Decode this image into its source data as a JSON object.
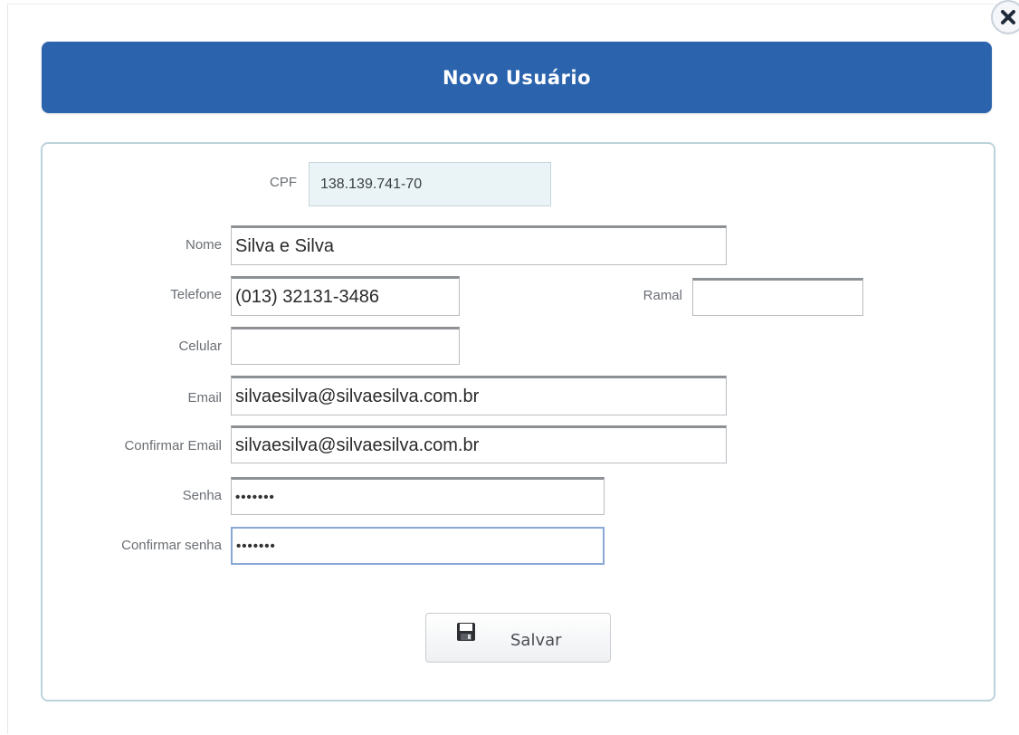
{
  "dialog": {
    "title": "Novo Usuário",
    "close_icon": "close-icon"
  },
  "form": {
    "cpf": {
      "label": "CPF",
      "value": "138.139.741-70"
    },
    "nome": {
      "label": "Nome",
      "value": "Silva e Silva"
    },
    "telefone": {
      "label": "Telefone",
      "value": "(013) 32131-3486"
    },
    "ramal": {
      "label": "Ramal",
      "value": ""
    },
    "celular": {
      "label": "Celular",
      "value": ""
    },
    "email": {
      "label": "Email",
      "value": "silvaesilva@silvaesilva.com.br"
    },
    "confirmar_email": {
      "label": "Confirmar Email",
      "value": "silvaesilva@silvaesilva.com.br"
    },
    "senha": {
      "label": "Senha",
      "value": "•••••••"
    },
    "confirmar_senha": {
      "label": "Confirmar senha",
      "value": "•••••••"
    }
  },
  "actions": {
    "save_label": "Salvar",
    "save_icon": "floppy-disk-icon"
  },
  "colors": {
    "header_bg": "#2b63ad",
    "panel_border": "#bcd3db",
    "readonly_bg": "#eaf3f6"
  }
}
